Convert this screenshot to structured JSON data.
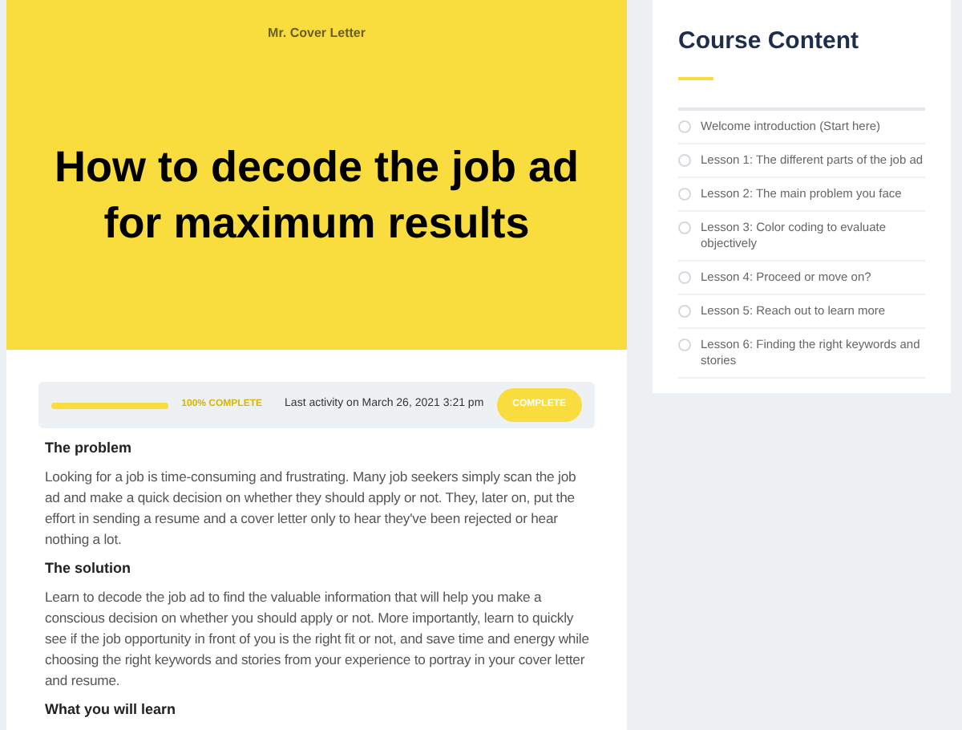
{
  "hero": {
    "brand": "Mr. Cover Letter",
    "title": "How to decode the job ad for maximum results"
  },
  "progress": {
    "level": 1,
    "label": "100% COMPLETE",
    "activity": "Last activity on March 26, 2021 3:21 pm",
    "button": "COMPLETE"
  },
  "content": [
    {
      "kind": "heading",
      "text": "The problem"
    },
    {
      "kind": "paragraph",
      "text": "Looking for a job is time-consuming and frustrating. Many job seekers simply scan the job ad and make a quick decision on whether they should apply or not. They, later on, put the effort in sending a resume and a cover letter only to hear they've been rejected or hear nothing a lot."
    },
    {
      "kind": "heading",
      "text": "The solution"
    },
    {
      "kind": "paragraph",
      "text": "Learn to decode the job ad to find the valuable information that will help you make a conscious decision on whether you should apply or not. More importantly, learn to quickly see if the job opportunity in front of you is the right fit or not, and save time and energy while choosing the right keywords and stories from your experience to portray in your cover letter and resume."
    },
    {
      "kind": "heading",
      "text": "What you will learn"
    }
  ],
  "sidebar": {
    "title": "Course Content",
    "lessons": [
      {
        "label": "Welcome introduction (Start here)",
        "completed": false
      },
      {
        "label": "Lesson 1: The different parts of the job ad",
        "completed": false
      },
      {
        "label": "Lesson 2: The main problem you face",
        "completed": false
      },
      {
        "label": "Lesson 3: Color coding to evaluate objectively",
        "completed": false
      },
      {
        "label": "Lesson 4: Proceed or move on?",
        "completed": false
      },
      {
        "label": "Lesson 5: Reach out to learn more",
        "completed": false
      },
      {
        "label": "Lesson 6: Finding the right keywords and stories",
        "completed": false
      }
    ]
  }
}
